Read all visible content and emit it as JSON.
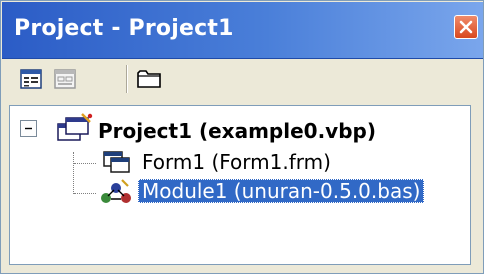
{
  "window": {
    "title": "Project - Project1"
  },
  "toolbar": {
    "buttons": [
      {
        "name": "view-code",
        "icon": "view-code-icon"
      },
      {
        "name": "view-object",
        "icon": "view-object-icon"
      },
      {
        "name": "toggle-folders",
        "icon": "folder-icon"
      }
    ]
  },
  "tree": {
    "root": {
      "label": "Project1 (example0.vbp)",
      "icon": "vb-project-icon",
      "expander": "minus"
    },
    "children": [
      {
        "label": "Form1 (Form1.frm)",
        "icon": "form-icon",
        "selected": false
      },
      {
        "label": "Module1 (unuran-0.5.0.bas)",
        "icon": "module-icon",
        "selected": true
      }
    ]
  },
  "colors": {
    "titlebar": "#2b5cc6",
    "close_button": "#d8481f",
    "selection": "#3169c6",
    "panel": "#ece9d8"
  }
}
